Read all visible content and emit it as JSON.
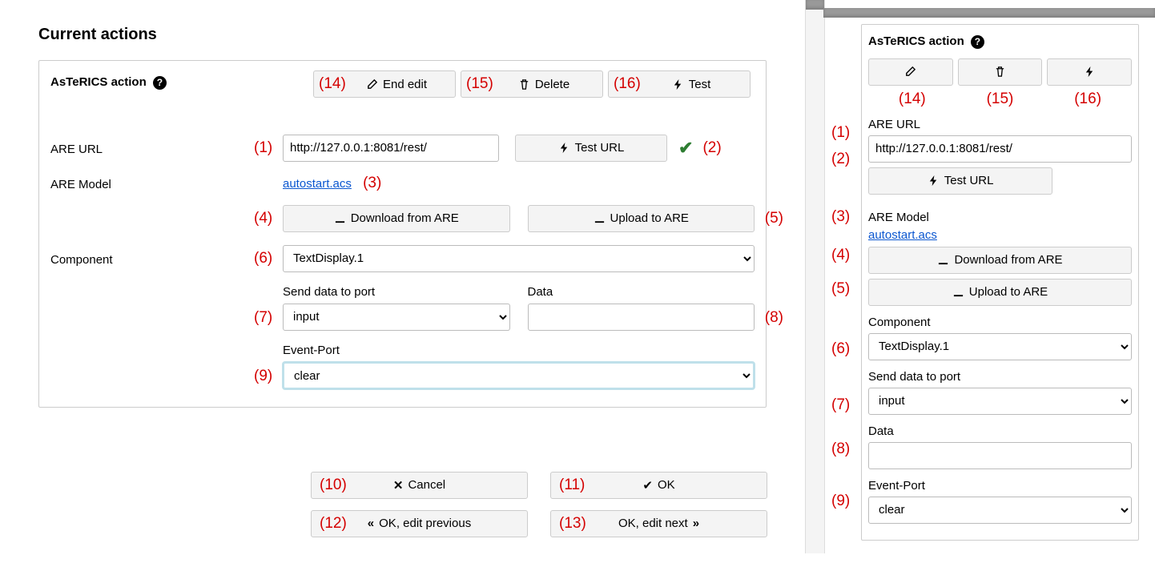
{
  "left": {
    "heading": "Current actions",
    "card_title": "AsTeRICS action",
    "top_buttons": {
      "end_edit": "End edit",
      "delete": "Delete",
      "test": "Test"
    },
    "are_url": {
      "label": "ARE URL",
      "value": "http://127.0.0.1:8081/rest/",
      "test_btn": "Test URL"
    },
    "are_model": {
      "label": "ARE Model",
      "link": "autostart.acs",
      "download": "Download from ARE",
      "upload": "Upload to ARE"
    },
    "component": {
      "label": "Component",
      "value": "TextDisplay.1"
    },
    "send_port": {
      "label": "Send data to port",
      "value": "input"
    },
    "data_field": {
      "label": "Data",
      "value": ""
    },
    "event_port": {
      "label": "Event-Port",
      "value": "clear"
    },
    "bottom": {
      "cancel": "Cancel",
      "ok": "OK",
      "ok_prev": "OK, edit previous",
      "ok_next": "OK, edit next"
    },
    "marks": {
      "m1": "(1)",
      "m2": "(2)",
      "m3": "(3)",
      "m4": "(4)",
      "m5": "(5)",
      "m6": "(6)",
      "m7": "(7)",
      "m8": "(8)",
      "m9": "(9)",
      "m10": "(10)",
      "m11": "(11)",
      "m12": "(12)",
      "m13": "(13)",
      "m14": "(14)",
      "m15": "(15)",
      "m16": "(16)"
    }
  },
  "right": {
    "card_title": "AsTeRICS action",
    "are_url": {
      "label": "ARE URL",
      "value": "http://127.0.0.1:8081/rest/",
      "test_btn": "Test URL"
    },
    "are_model": {
      "label": "ARE Model",
      "link": "autostart.acs",
      "download": "Download from ARE",
      "upload": "Upload to ARE"
    },
    "component": {
      "label": "Component",
      "value": "TextDisplay.1"
    },
    "send_port": {
      "label": "Send data to port",
      "value": "input"
    },
    "data_field": {
      "label": "Data",
      "value": ""
    },
    "event_port": {
      "label": "Event-Port",
      "value": "clear"
    },
    "marks": {
      "m1": "(1)",
      "m2": "(2)",
      "m3": "(3)",
      "m4": "(4)",
      "m5": "(5)",
      "m6": "(6)",
      "m7": "(7)",
      "m8": "(8)",
      "m9": "(9)",
      "m14": "(14)",
      "m15": "(15)",
      "m16": "(16)"
    }
  }
}
